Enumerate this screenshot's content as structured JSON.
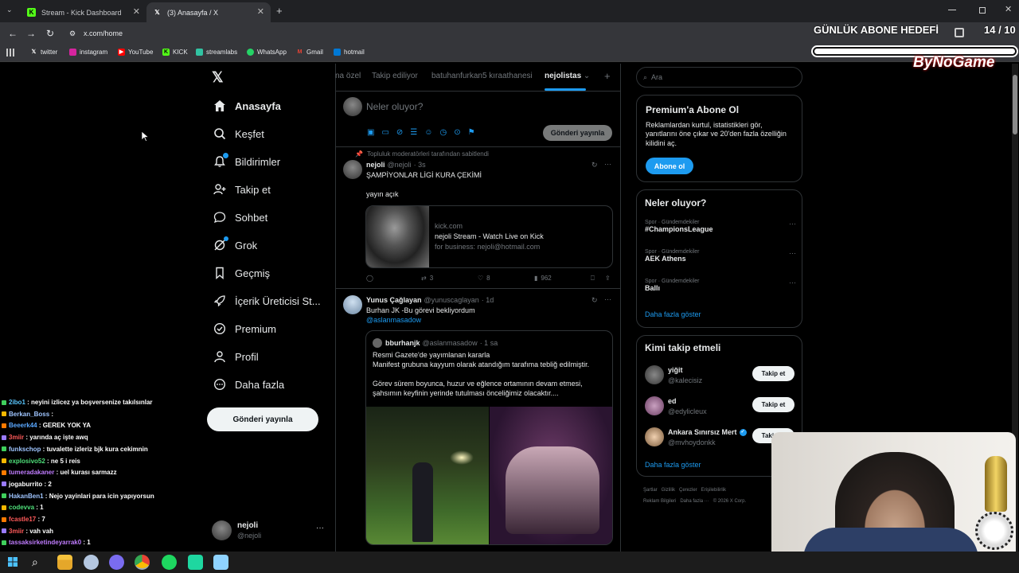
{
  "browser": {
    "tabs": [
      {
        "title": "Stream - Kick Dashboard"
      },
      {
        "title": "(3) Anasayfa / X"
      }
    ],
    "url": "x.com/home",
    "bookmarks": [
      "twitter",
      "instagram",
      "YouTube",
      "KICK",
      "streamlabs",
      "WhatsApp",
      "Gmail",
      "hotmail"
    ]
  },
  "overlay": {
    "goal_label": "GÜNLÜK ABONE HEDEFİ",
    "goal_count": "14 / 10",
    "brand": "ByNoGame"
  },
  "sidebar": {
    "items": [
      "Anasayfa",
      "Keşfet",
      "Bildirimler",
      "Takip et",
      "Sohbet",
      "Grok",
      "Geçmiş",
      "İçerik Üreticisi St...",
      "Premium",
      "Profil",
      "Daha fazla"
    ],
    "post_button": "Gönderi yayınla",
    "account_name": "nejoli",
    "account_handle": "@nejoli"
  },
  "feed": {
    "tabs": [
      "na özel",
      "Takip ediliyor",
      "batuhanfurkan5 kıraathanesi",
      "nejolistas"
    ],
    "compose_placeholder": "Neler oluyor?",
    "compose_button": "Gönderi yayınla",
    "pinned_note": "Topluluk moderatörleri tarafından sabitlendi",
    "post1": {
      "name": "nejoli",
      "handle": "@nejoli",
      "time": "· 3s",
      "text1": "ŞAMPİYONLAR LİGİ KURA ÇEKİMİ",
      "text2": "yayın açık",
      "card_domain": "kick.com",
      "card_title": "nejoli Stream - Watch Live on Kick",
      "card_desc": "for business: nejoli@hotmail.com",
      "retweets": "3",
      "likes": "8",
      "views": "962"
    },
    "post2": {
      "name": "Yunus Çağlayan",
      "handle": "@yunuscaglayan",
      "time": "· 1d",
      "text": "Burhan JK -Bu görevi bekliyordum",
      "mention": "@aslanmasadow",
      "quote_name": "bburhanjk",
      "quote_handle": "@aslanmasadow",
      "quote_time": "· 1 sa",
      "quote_line1": "Resmi Gazete'de yayımlanan kararla",
      "quote_line2": "Manifest grubuna kayyum olarak atandığım tarafıma tebliğ edilmiştir.",
      "quote_line3": "Görev sürem boyunca, huzur ve eğlence ortamının devam etmesi,",
      "quote_line4": "şahsımın keyfinin yerinde tutulması önceliğimiz olacaktır...."
    }
  },
  "right": {
    "search_placeholder": "Ara",
    "premium_title": "Premium'a Abone Ol",
    "premium_text": [
      "Reklamlardan kurtul, istatistikleri gör,",
      "yanıtlarını öne çıkar ve 20'den fazla özelliğin",
      "kilidini aç."
    ],
    "premium_button": "Abone ol",
    "trends_title": "Neler oluyor?",
    "trends": [
      {
        "cat": "Spor · Gündemdekiler",
        "name": "#ChampionsLeague"
      },
      {
        "cat": "Spor · Gündemdekiler",
        "name": "AEK Athens"
      },
      {
        "cat": "Spor · Gündemdekiler",
        "name": "Ballı"
      }
    ],
    "show_more": "Daha fazla göster",
    "follow_title": "Kimi takip etmeli",
    "follow": [
      {
        "name": "yiğit",
        "handle": "@kalecisiz",
        "button": "Takip et"
      },
      {
        "name": "ed",
        "handle": "@edylicleux",
        "button": "Takip et"
      },
      {
        "name": "Ankara Sınırsız Mert",
        "handle": "@mvhoydonkk",
        "button": "Takip et"
      }
    ],
    "follow_more": "Daha fazla göster",
    "footer1": "Şartlar   Gizlilik   Çerezler   Erişilebilirlik",
    "footer2": "Reklam Bilgileri   Daha fazla ···   © 2026 X Corp."
  },
  "chat": [
    {
      "user": "2ibo1",
      "msg": "neyini izlicez ya boşversenize takılsınlar",
      "color": "#59c7ff"
    },
    {
      "user": "Berkan_Boss",
      "msg": "",
      "color": "#9fc5ff"
    },
    {
      "user": "Beeerk44",
      "msg": "GEREK YOK YA",
      "color": "#5aa8ff"
    },
    {
      "user": "3miir",
      "msg": "yarında aç işte awq",
      "color": "#ff5a5a"
    },
    {
      "user": "funkschop",
      "msg": "tuvalette izleriz bjk kura cekimnin",
      "color": "#9fc5ff"
    },
    {
      "user": "explosivo52",
      "msg": "ne 5 i reis",
      "color": "#4fe07a"
    },
    {
      "user": "tumeradakaner",
      "msg": "uel kurası sarmazz",
      "color": "#c07cff"
    },
    {
      "user": "jogaburrito",
      "msg": "2",
      "color": "#ffffff"
    },
    {
      "user": "HakanBen1",
      "msg": "Nejo yayinlari para icin yapıyorsun",
      "color": "#9fc5ff"
    },
    {
      "user": "codevva",
      "msg": "1",
      "color": "#4fe07a"
    },
    {
      "user": "fcastle17",
      "msg": "7",
      "color": "#ff5a5a"
    },
    {
      "user": "3miir",
      "msg": "vah vah",
      "color": "#ff5a5a"
    },
    {
      "user": "tassaksirketindeyarrak0",
      "msg": "1",
      "color": "#c07cff"
    }
  ],
  "colors": {
    "accent": "#1d9bf0",
    "bg": "#000000",
    "border": "#2f3336",
    "muted": "#71767b"
  }
}
